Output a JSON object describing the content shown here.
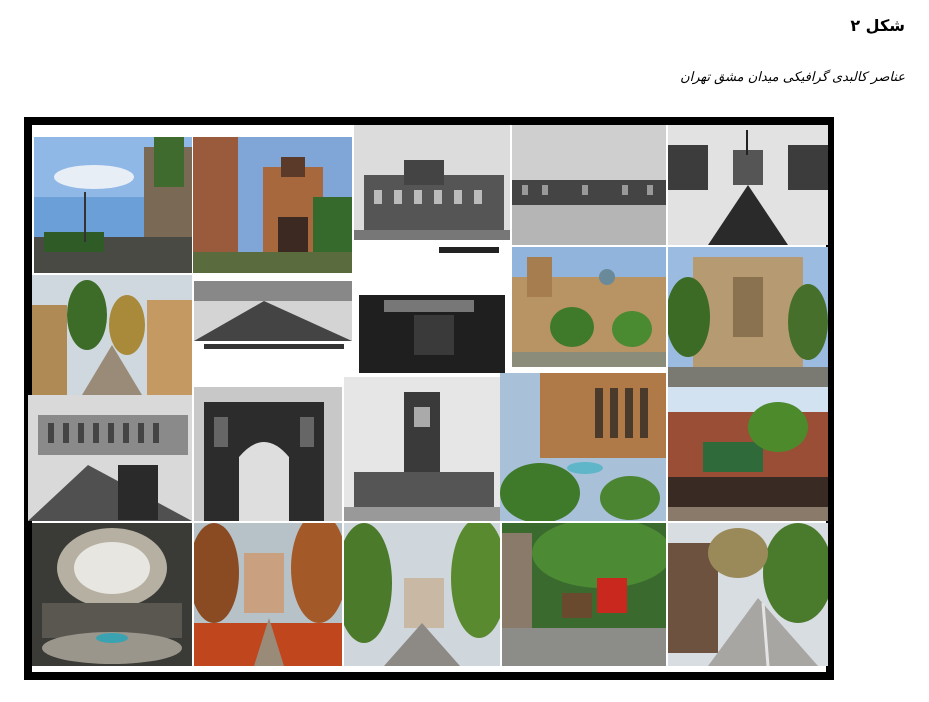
{
  "figure": {
    "title": "شکل ۲",
    "caption": "عناصر کالبدی گرافیکی میدان مشق تهران"
  },
  "photo_tiles": [
    {
      "name": "photo-street-sky",
      "palette": "color"
    },
    {
      "name": "photo-gate-colorful",
      "palette": "color"
    },
    {
      "name": "photo-historic-building-bw-1",
      "palette": "bw"
    },
    {
      "name": "photo-square-bw",
      "palette": "bw"
    },
    {
      "name": "photo-avenue-bw",
      "palette": "bw"
    },
    {
      "name": "photo-boulevard-trees",
      "palette": "color"
    },
    {
      "name": "photo-old-street-bw",
      "palette": "bw"
    },
    {
      "name": "photo-building-bw-2",
      "palette": "bw"
    },
    {
      "name": "photo-palace-facade",
      "palette": "color"
    },
    {
      "name": "photo-ministry-building",
      "palette": "color"
    },
    {
      "name": "photo-plaza-bw",
      "palette": "bw"
    },
    {
      "name": "photo-arch-gate-bw",
      "palette": "bw"
    },
    {
      "name": "photo-tower-gate-bw",
      "palette": "bw"
    },
    {
      "name": "photo-garden-courtyard",
      "palette": "color"
    },
    {
      "name": "photo-brick-building-fence",
      "palette": "color"
    },
    {
      "name": "photo-rotunda-interior",
      "palette": "color"
    },
    {
      "name": "photo-autumn-path",
      "palette": "color"
    },
    {
      "name": "photo-tree-lined-walk",
      "palette": "color"
    },
    {
      "name": "photo-carriage-street",
      "palette": "color"
    },
    {
      "name": "photo-cobbled-street",
      "palette": "color"
    }
  ]
}
